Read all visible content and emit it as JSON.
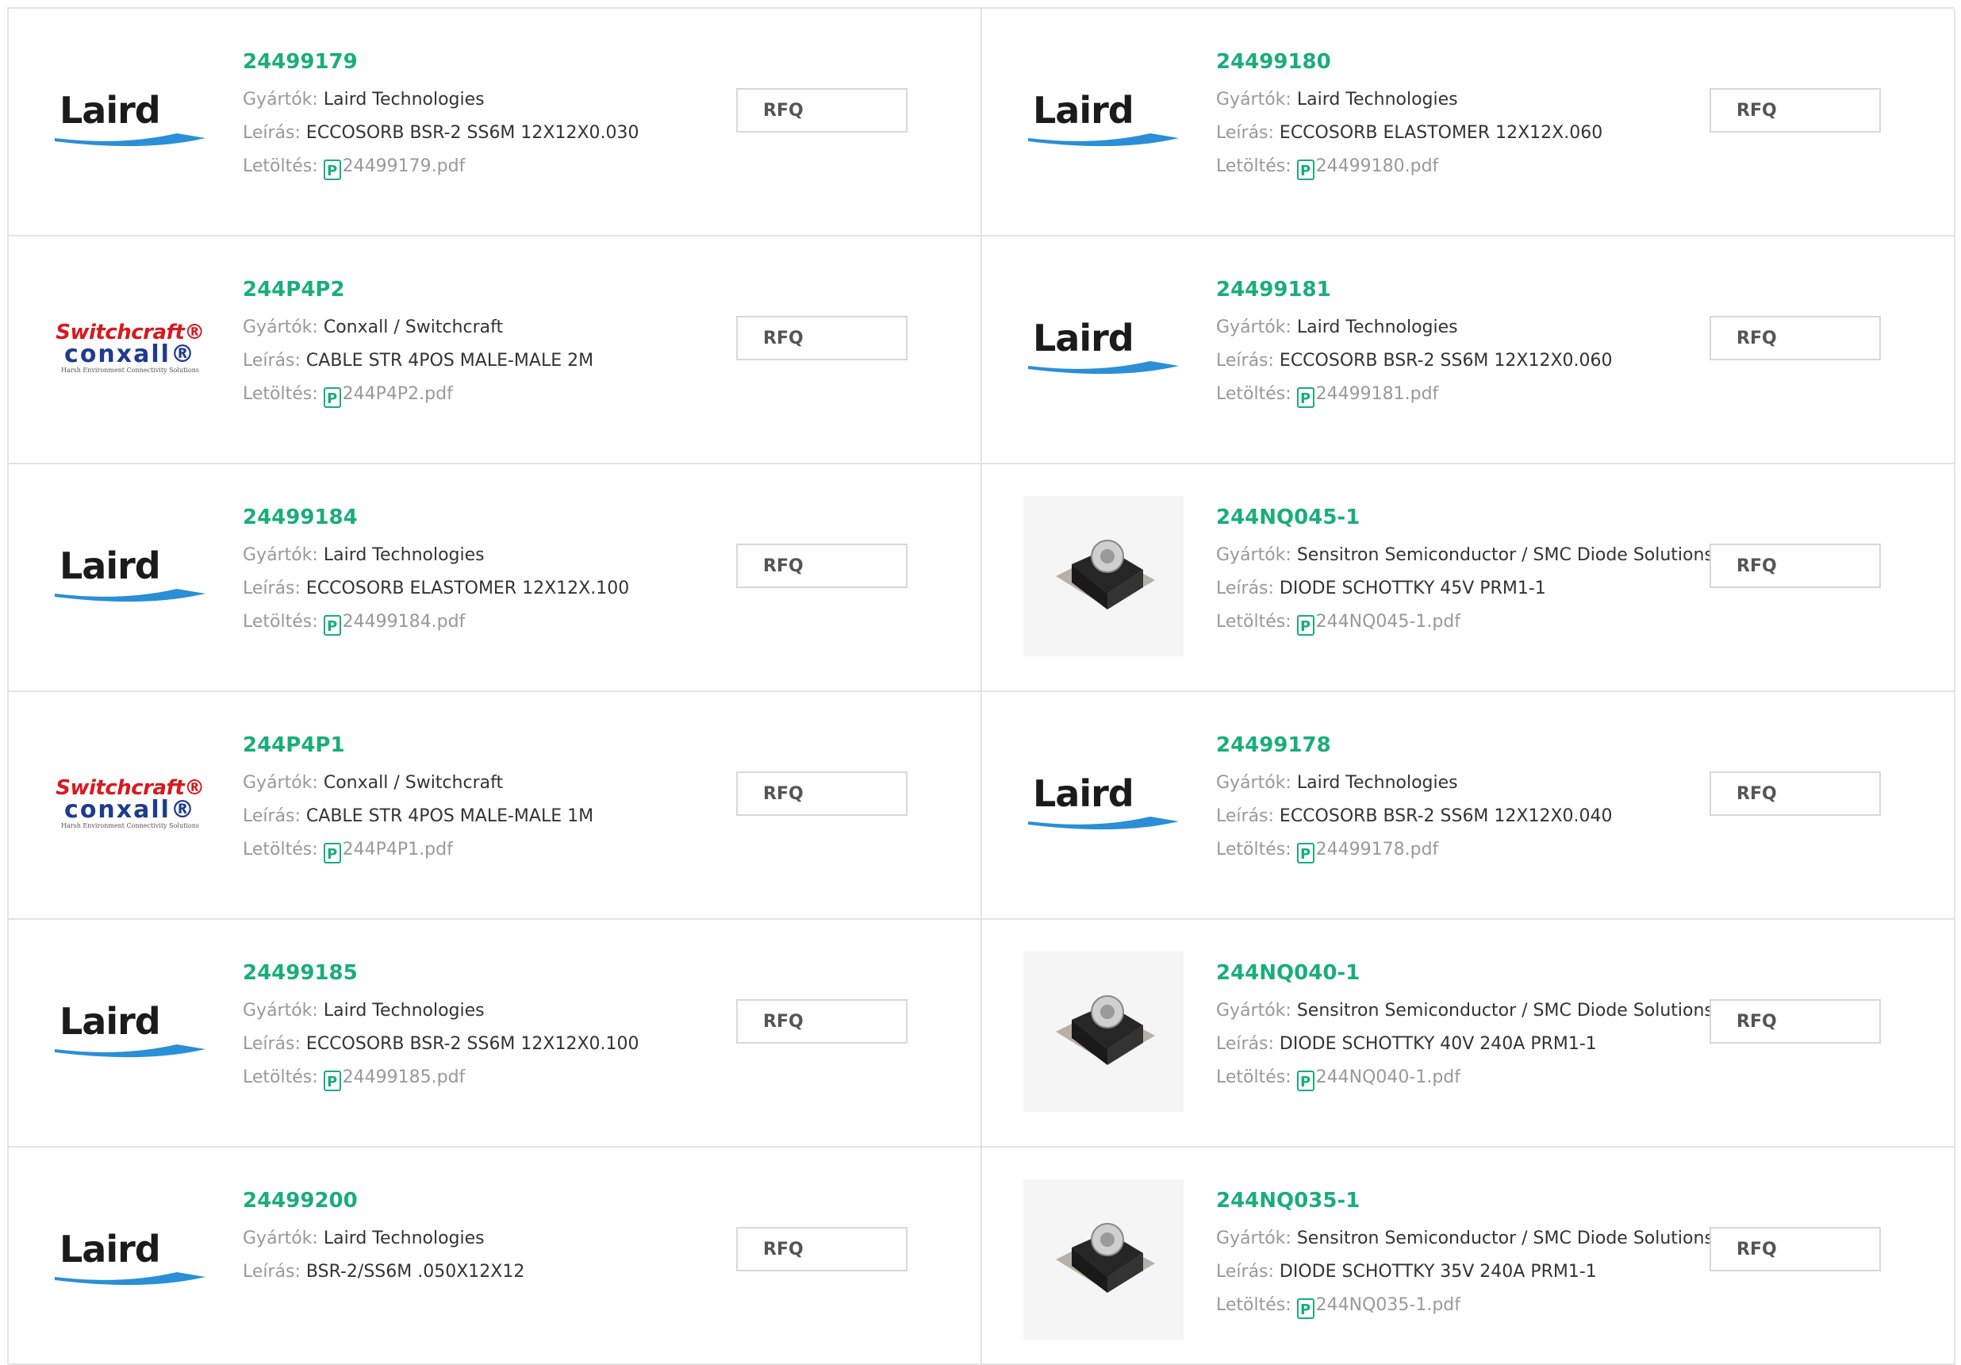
{
  "labels": {
    "manufacturer": "Gyártók:",
    "description": "Leírás:",
    "download": "Letöltés:",
    "rfq": "RFQ"
  },
  "items": [
    {
      "pn": "24499179",
      "manufacturer": "Laird Technologies",
      "description": "ECCOSORB BSR-2 SS6M 12X12X0.030",
      "pdf": "24499179.pdf",
      "logo": "laird-logo"
    },
    {
      "pn": "24499180",
      "manufacturer": "Laird Technologies",
      "description": "ECCOSORB ELASTOMER 12X12X.060",
      "pdf": "24499180.pdf",
      "logo": "laird-logo"
    },
    {
      "pn": "244P4P2",
      "manufacturer": "Conxall / Switchcraft",
      "description": "CABLE STR 4POS MALE-MALE 2M",
      "pdf": "244P4P2.pdf",
      "logo": "switchcraft-conxall-logo"
    },
    {
      "pn": "24499181",
      "manufacturer": "Laird Technologies",
      "description": "ECCOSORB BSR-2 SS6M 12X12X0.060",
      "pdf": "24499181.pdf",
      "logo": "laird-logo"
    },
    {
      "pn": "24499184",
      "manufacturer": "Laird Technologies",
      "description": "ECCOSORB ELASTOMER 12X12X.100",
      "pdf": "24499184.pdf",
      "logo": "laird-logo"
    },
    {
      "pn": "244NQ045-1",
      "manufacturer": "Sensitron Semiconductor / SMC Diode Solutions",
      "description": "DIODE SCHOTTKY 45V PRM1-1",
      "pdf": "244NQ045-1.pdf",
      "logo": "diode-photo"
    },
    {
      "pn": "244P4P1",
      "manufacturer": "Conxall / Switchcraft",
      "description": "CABLE STR 4POS MALE-MALE 1M",
      "pdf": "244P4P1.pdf",
      "logo": "switchcraft-conxall-logo"
    },
    {
      "pn": "24499178",
      "manufacturer": "Laird Technologies",
      "description": "ECCOSORB BSR-2 SS6M 12X12X0.040",
      "pdf": "24499178.pdf",
      "logo": "laird-logo"
    },
    {
      "pn": "24499185",
      "manufacturer": "Laird Technologies",
      "description": "ECCOSORB BSR-2 SS6M 12X12X0.100",
      "pdf": "24499185.pdf",
      "logo": "laird-logo"
    },
    {
      "pn": "244NQ040-1",
      "manufacturer": "Sensitron Semiconductor / SMC Diode Solutions",
      "description": "DIODE SCHOTTKY 40V 240A PRM1-1",
      "pdf": "244NQ040-1.pdf",
      "logo": "diode-photo"
    },
    {
      "pn": "24499200",
      "manufacturer": "Laird Technologies",
      "description": "BSR-2/SS6M .050X12X12",
      "pdf": null,
      "logo": "laird-logo"
    },
    {
      "pn": "244NQ035-1",
      "manufacturer": "Sensitron Semiconductor / SMC Diode Solutions",
      "description": "DIODE SCHOTTKY 35V 240A PRM1-1",
      "pdf": "244NQ035-1.pdf",
      "logo": "diode-photo"
    }
  ],
  "logos": {
    "laird": {
      "word": "Laird",
      "swoosh_color": "#2a8fd6"
    },
    "switchcraft": {
      "top": "Switchcraft",
      "mid": "conxall",
      "bottom": "Harsh Environment Connectivity Solutions"
    }
  },
  "colors": {
    "accent": "#1aad7b",
    "label": "#999999",
    "border": "#e3e3e3"
  }
}
